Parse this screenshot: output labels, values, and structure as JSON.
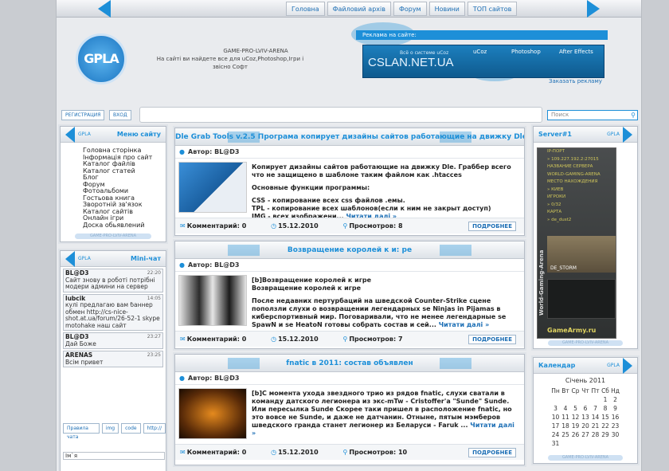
{
  "nav": {
    "links": [
      "Головна",
      "Файловий архів",
      "Форум",
      "Новини",
      "ТОП сайтов"
    ]
  },
  "header": {
    "logo_text": "GPLA",
    "site_name": "GAME-PRO-LVIV-ARENA",
    "site_desc": "На сайті ви найдете все для uCoz,Photoshop,Ігри і звісно Софт",
    "ad_label": "Реклама на сайте:",
    "banner_small": "Всё о системе uCoz",
    "banner_big": "CSLAN.NET.UA",
    "banner_tabs": [
      "uCoz",
      "Photoshop",
      "After Effects"
    ],
    "ad_order": "Заказать рекламу"
  },
  "loginbar": {
    "register": "РЕГИСТРАЦИЯ",
    "login": "ВХОД",
    "search_placeholder": "Поиск"
  },
  "menu": {
    "title": "Меню сайту",
    "small": "GPLA",
    "items": [
      "Головна сторінка",
      "Інформація про сайт",
      "Каталог файлів",
      "Каталог статей",
      "Блог",
      "Форум",
      "Фотоальбоми",
      "Гостьова книга",
      "Зворотній зв'язок",
      "Каталог сайтів",
      "Онлайн ігри",
      "Доска обьявлений"
    ],
    "foot": "GAME-PRO-LVIV-ARENA"
  },
  "chat": {
    "title": "Mini-чат",
    "small": "GPLA",
    "messages": [
      {
        "user": "BL@D3",
        "time": "22:20",
        "text": "Сайт знову в роботі потрібні модери админи на сервер"
      },
      {
        "user": "lubcik",
        "time": "14:05",
        "text": "кулі предлагаю вам баннер обмен http://cs-nice-shot.at.ua/forum/26-52-1 skype motohake наш сайт разумеется тоже"
      },
      {
        "user": "BL@D3",
        "time": "23:27",
        "text": "Дай Боже"
      },
      {
        "user": "ARENAS",
        "time": "23:25",
        "text": "Всім привет"
      }
    ],
    "tools": [
      "Правила чата",
      "img",
      "code",
      "http://"
    ],
    "name_field": "Ім`я"
  },
  "posts": [
    {
      "title": "Dle Grab Tools v.2.5 Програма копирует дизайны сайтов работающие на движку Dle",
      "author": "Автор: BL@D3",
      "body": [
        "Копирует дизайны сайтов работающие на движку Dle. Граббер всего что не защищено в шаблоне таким файлом как .htacces",
        "",
        "Основные функции программы:",
        "",
        "CSS - копирование всех css файлов .емы.",
        "TPL - копирование всех шаблонов(если к ним не закрыт доступ)",
        "IMG - всех изображени..."
      ],
      "read_more": "Читати далі »",
      "comments": "Комментарий: 0",
      "date": "15.12.2010",
      "views": "Просмотров: 8",
      "more": "ПОДРОБНЕЕ"
    },
    {
      "title": "Возвращение королей к и: pe",
      "author": "Автор: BL@D3",
      "body": [
        "[b]Возвращение королей к игре",
        "Возвращение королей к игре",
        "",
        "После недавних пертурбаций на шведской Counter-Strike сцене поползли слухи о возвращении легендарных se Ninjas in Pijamas в киберспортивный мир. Поговаривали, что не менее легендарные se SpawN и se HeatoN готовы собрать состав и сей..."
      ],
      "read_more": "Читати далі »",
      "comments": "Комментарий: 0",
      "date": "15.12.2010",
      "views": "Просмотров: 7",
      "more": "ПОДРОБНЕЕ"
    },
    {
      "title": "fnatic в 2011: состав объявлен",
      "author": "Автор: BL@D3",
      "body": [
        "[b]С момента ухода звездного трио из рядов fnatic, слухи сватали в команду датского легионера из экс-mTw - Cristoffer'a \"Sunde\" Sunde. Или пересылка Sunde Скорее таки пришел в расположение fnatic, но это вовсе не Sunde, и даже не датчанин. Отныне, пятым мэмберов шведского гранда станет легионер из Беларуси - Faruk ..."
      ],
      "read_more": "Читати далі »",
      "comments": "Комментарий: 0",
      "date": "15.12.2010",
      "views": "Просмотров: 10",
      "more": "ПОДРОБНЕЕ"
    }
  ],
  "server": {
    "title": "Server#1",
    "small": "GPLA",
    "vertical": "World-Gaming-Arena",
    "rows": [
      "IP-ПОРТ",
      "» 109.227.192.2:27015",
      "НАЗВАНИЕ СЕРВЕРА",
      "WORLD-GAMING-ARENA",
      "",
      "МЕСТО НАХОЖДЕНИЯ",
      "» КИЕВ",
      "ИГРОКИ",
      "» 0/32",
      "КАРТА",
      "» de_dust2"
    ],
    "map_name": "DE_STORM",
    "brand": "GameArmy.ru",
    "foot": "GAME-PRO-LVIV-ARENA"
  },
  "calendar": {
    "title": "Календар",
    "small": "GPLA",
    "month": "Січень 2011",
    "weekdays": [
      "Пн",
      "Вт",
      "Ср",
      "Чт",
      "Пт",
      "Сб",
      "Нд"
    ],
    "weeks": [
      [
        "",
        "",
        "",
        "",
        "",
        "1",
        "2"
      ],
      [
        "3",
        "4",
        "5",
        "6",
        "7",
        "8",
        "9"
      ],
      [
        "10",
        "11",
        "12",
        "13",
        "14",
        "15",
        "16"
      ],
      [
        "17",
        "18",
        "19",
        "20",
        "21",
        "22",
        "23"
      ],
      [
        "24",
        "25",
        "26",
        "27",
        "28",
        "29",
        "30"
      ],
      [
        "31",
        "",
        "",
        "",
        "",
        "",
        ""
      ]
    ],
    "foot": "GAME-PRO-LVIV-ARENA"
  },
  "colors": {
    "accent": "#1d8fd8",
    "page_bg": "#e9ebee"
  }
}
